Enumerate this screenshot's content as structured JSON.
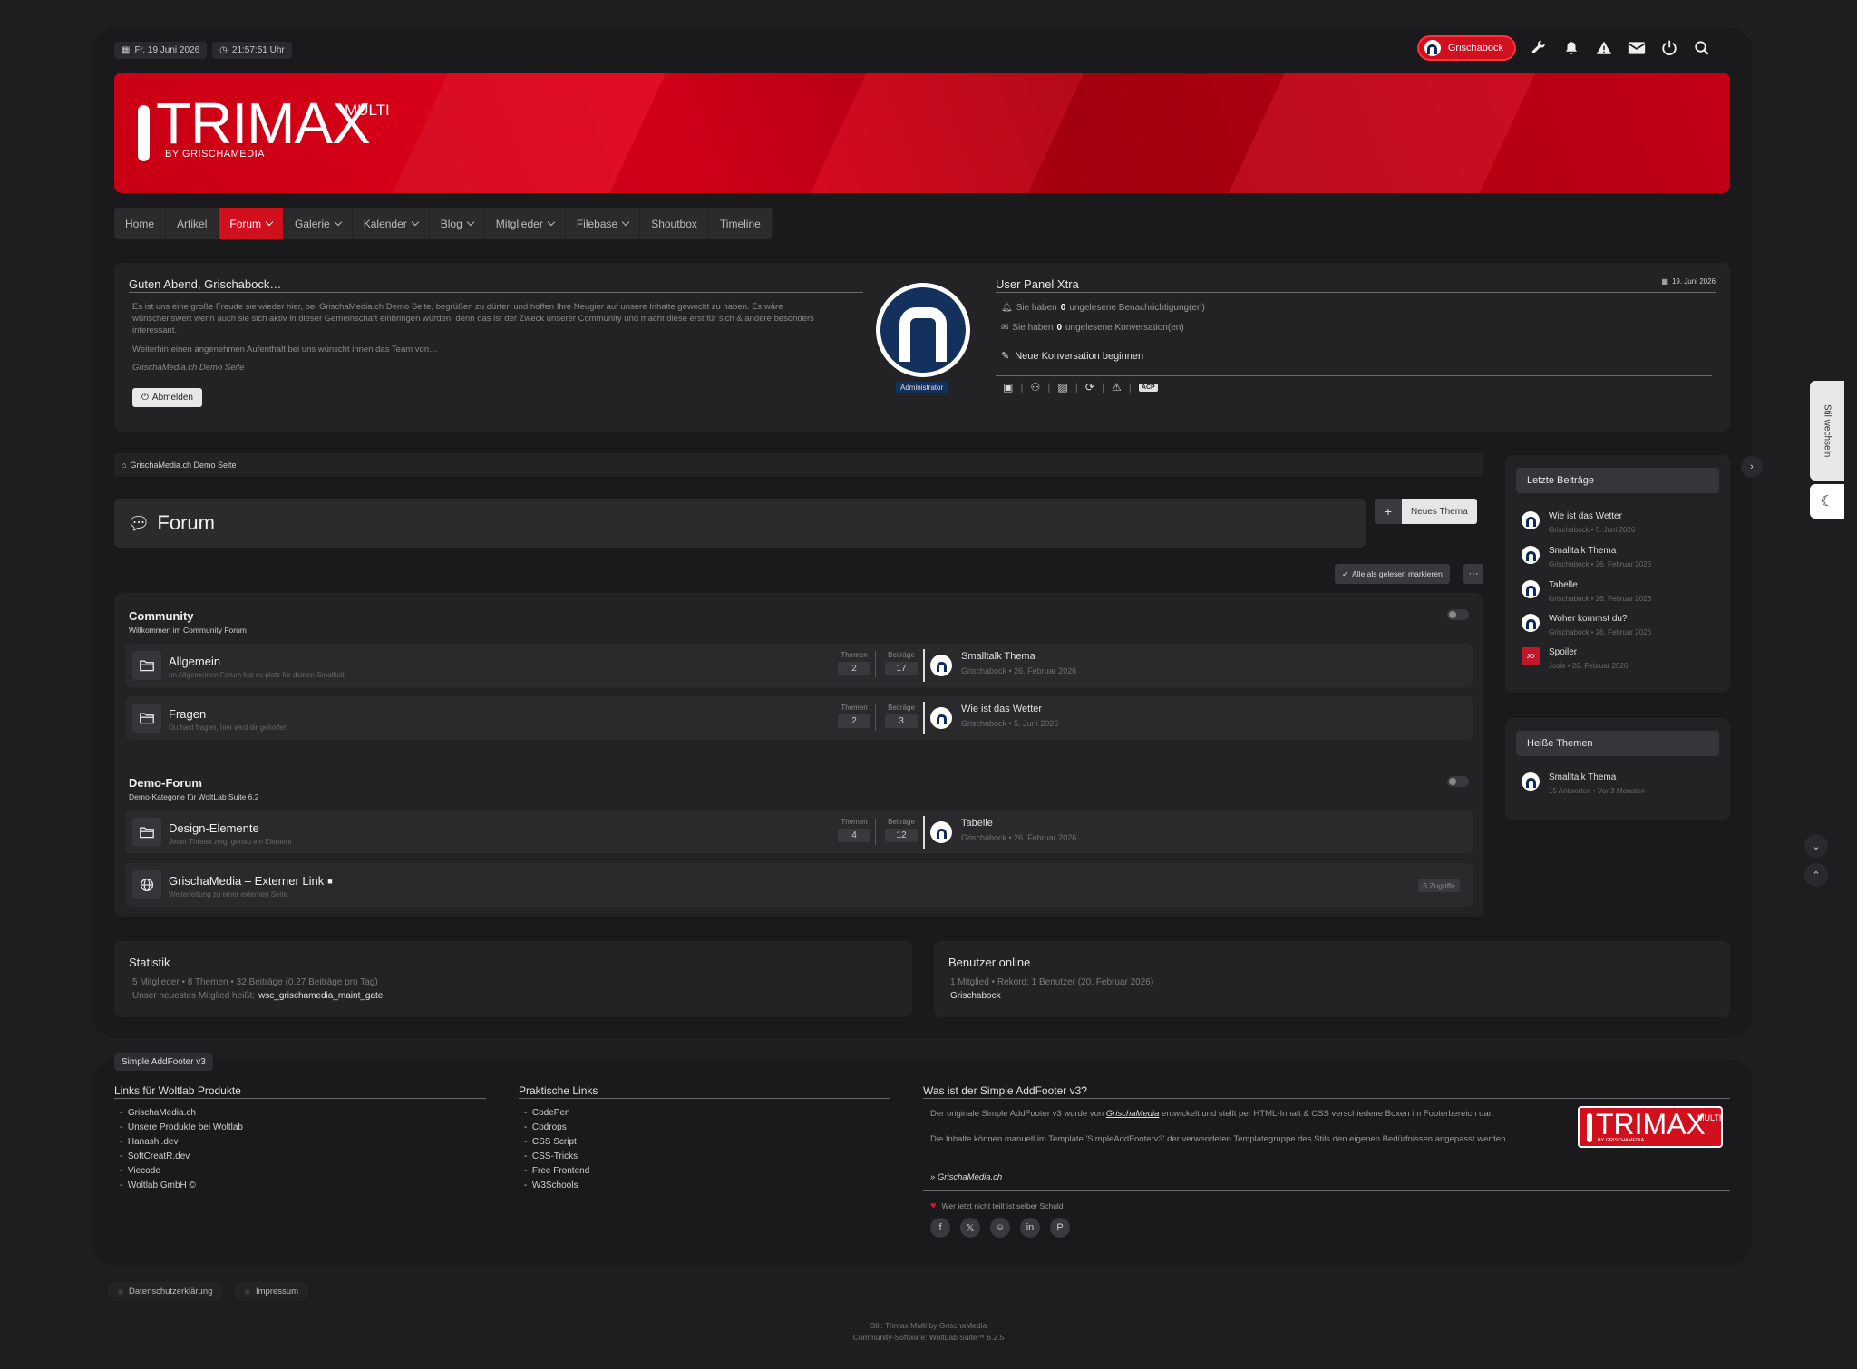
{
  "topbar": {
    "date": "Fr. 19 Juni 2026",
    "time": "21:57:51 Uhr",
    "username": "Grischabock"
  },
  "icons": {
    "wrench": "wrench-icon",
    "bell": "bell-icon",
    "warning": "warning-icon",
    "mail": "envelope-icon",
    "power": "power-icon",
    "search": "search-icon"
  },
  "logo": {
    "name": "TRIMAX",
    "multi": "MULTI",
    "by": "BY GRISCHAMEDIA"
  },
  "nav": [
    {
      "label": "Home"
    },
    {
      "label": "Artikel"
    },
    {
      "label": "Forum"
    },
    {
      "label": "Galerie"
    },
    {
      "label": "Kalender"
    },
    {
      "label": "Blog"
    },
    {
      "label": "Mitglieder"
    },
    {
      "label": "Filebase"
    },
    {
      "label": "Shoutbox"
    },
    {
      "label": "Timeline"
    }
  ],
  "welcome": {
    "title": "Guten Abend, Grischabock…",
    "text1": "Es ist uns eine große Freude sie wieder hier, bei GrischaMedia.ch Demo Seite, begrüßen zu dürfen und hoffen Ihre Neugier auf unsere Inhalte geweckt zu haben. Es wäre wünschenswert wenn auch sie sich aktiv in dieser Gemeinschaft einbringen würden, denn das ist der Zweck unserer Community und macht diese erst für sich & andere besonders interessant.",
    "text2": "Weiterhin einen angenehmen Aufenthalt bei uns wünscht ihnen das Team von…",
    "sign": "GrischaMedia.ch Demo Seite",
    "logout": "Abmelden",
    "role": "Administrator"
  },
  "userpanel": {
    "title": "User Panel Xtra",
    "date": "19. Juni 2026",
    "notif_pre": "Sie haben",
    "notif_count": "0",
    "notif_post": "ungelesene Benachrichtigung(en)",
    "conv_pre": "Sie haben",
    "conv_count": "0",
    "conv_post": "ungelesene Konversation(en)",
    "new_conv": "Neue Konversation beginnen",
    "acp": "ACP"
  },
  "breadcrumb": "GrischaMedia.ch Demo Seite",
  "forum": {
    "title": "Forum",
    "new_topic": "Neues Thema",
    "mark_read": "Alle als gelesen markieren"
  },
  "stat_labels": {
    "topics": "Themen",
    "posts": "Beiträge"
  },
  "categories": [
    {
      "title": "Community",
      "desc": "Willkommen im Community Forum",
      "boards": [
        {
          "name": "Allgemein",
          "desc": "Im Allgemeinen Forum hat es platz für deinen Smalltalk",
          "topics": "2",
          "posts": "17",
          "last_title": "Smalltalk Thema",
          "last_meta": "Grischabock • 26. Februar 2026"
        },
        {
          "name": "Fragen",
          "desc": "Du hast fragen, hier wird dir geholfen",
          "topics": "2",
          "posts": "3",
          "last_title": "Wie ist das Wetter",
          "last_meta": "Grischabock • 5. Juni 2026"
        }
      ]
    },
    {
      "title": "Demo-Forum",
      "desc": "Demo-Kategorie für WoltLab Suite 6.2",
      "boards": [
        {
          "name": "Design-Elemente",
          "desc": "Jeder Thread zeigt genau ein Element",
          "topics": "4",
          "posts": "12",
          "last_title": "Tabelle",
          "last_meta": "Grischabock • 26. Februar 2026"
        },
        {
          "name": "GrischaMedia – Externer Link",
          "desc": "Weiterleitung zu einer externen Seite",
          "hits": "6 Zugriffe"
        }
      ]
    }
  ],
  "sidebar": {
    "latest_title": "Letzte Beiträge",
    "latest": [
      {
        "title": "Wie ist das Wetter",
        "meta": "Grischabock • 5. Juni 2026"
      },
      {
        "title": "Smalltalk Thema",
        "meta": "Grischabock • 26. Februar 2026"
      },
      {
        "title": "Tabelle",
        "meta": "Grischabock • 26. Februar 2026"
      },
      {
        "title": "Woher kommst du?",
        "meta": "Grischabock • 26. Februar 2026"
      },
      {
        "title": "Spoiler",
        "meta": "Josie • 26. Februar 2026",
        "initials": "JO"
      }
    ],
    "hot_title": "Heiße Themen",
    "hot": [
      {
        "title": "Smalltalk Thema",
        "meta": "15 Antworten • Vor 3 Monaten"
      }
    ]
  },
  "style_switch": "Stil wechseln",
  "stats": {
    "title": "Statistik",
    "line1": "5 Mitglieder • 8 Themen • 32 Beiträge (0,27 Beiträge pro Tag)",
    "line2_pre": "Unser neuestes Mitglied heißt:",
    "line2_user": "wsc_grischamedia_maint_gate"
  },
  "online": {
    "title": "Benutzer online",
    "line1": "1 Mitglied • Rekord: 1 Benutzer (20. Februar 2026)",
    "user": "Grischabock"
  },
  "footer": {
    "tag": "Simple AddFooter v3",
    "col1_title": "Links für Woltlab Produkte",
    "col1": [
      "GrischaMedia.ch",
      "Unsere Produkte bei Woltlab",
      "Hanashi.dev",
      "SoftCreatR.dev",
      "Viecode",
      "Woltlab GmbH ©"
    ],
    "col2_title": "Praktische Links",
    "col2": [
      "CodePen",
      "Codrops",
      "CSS Script",
      "CSS-Tricks",
      "Free Frontend",
      "W3Schools"
    ],
    "col3_title": "Was ist der Simple AddFooter v3?",
    "col3_p1_pre": "Der originale Simple AddFooter v3 wurde von",
    "col3_p1_link": "GrischaMedia",
    "col3_p1_post": "entwickelt und stellt per HTML-Inhalt & CSS verschiedene Boxen im Footerbereich dar.",
    "col3_p2": "Die Inhalte können manuell im Template 'SimpleAddFooterv3' der verwendeten Templategruppe des Stils den eigenen Bedürfnissen angepasst werden.",
    "col3_link": "» GrischaMedia.ch",
    "share": "Wer jetzt nicht teilt ist selber Schuld",
    "socials": [
      "facebook-icon",
      "x-icon",
      "reddit-icon",
      "linkedin-icon",
      "pinterest-icon"
    ]
  },
  "bottom": {
    "privacy": "Datenschutzerklärung",
    "imprint": "Impressum",
    "credit1": "Stil: Trimax Multi by GrischaMedia",
    "credit2": "Community-Software: WoltLab Suite™ 6.2.5"
  },
  "colors": {
    "accent": "#d1101d",
    "bg": "#1a1a1c",
    "panel": "#232326"
  }
}
